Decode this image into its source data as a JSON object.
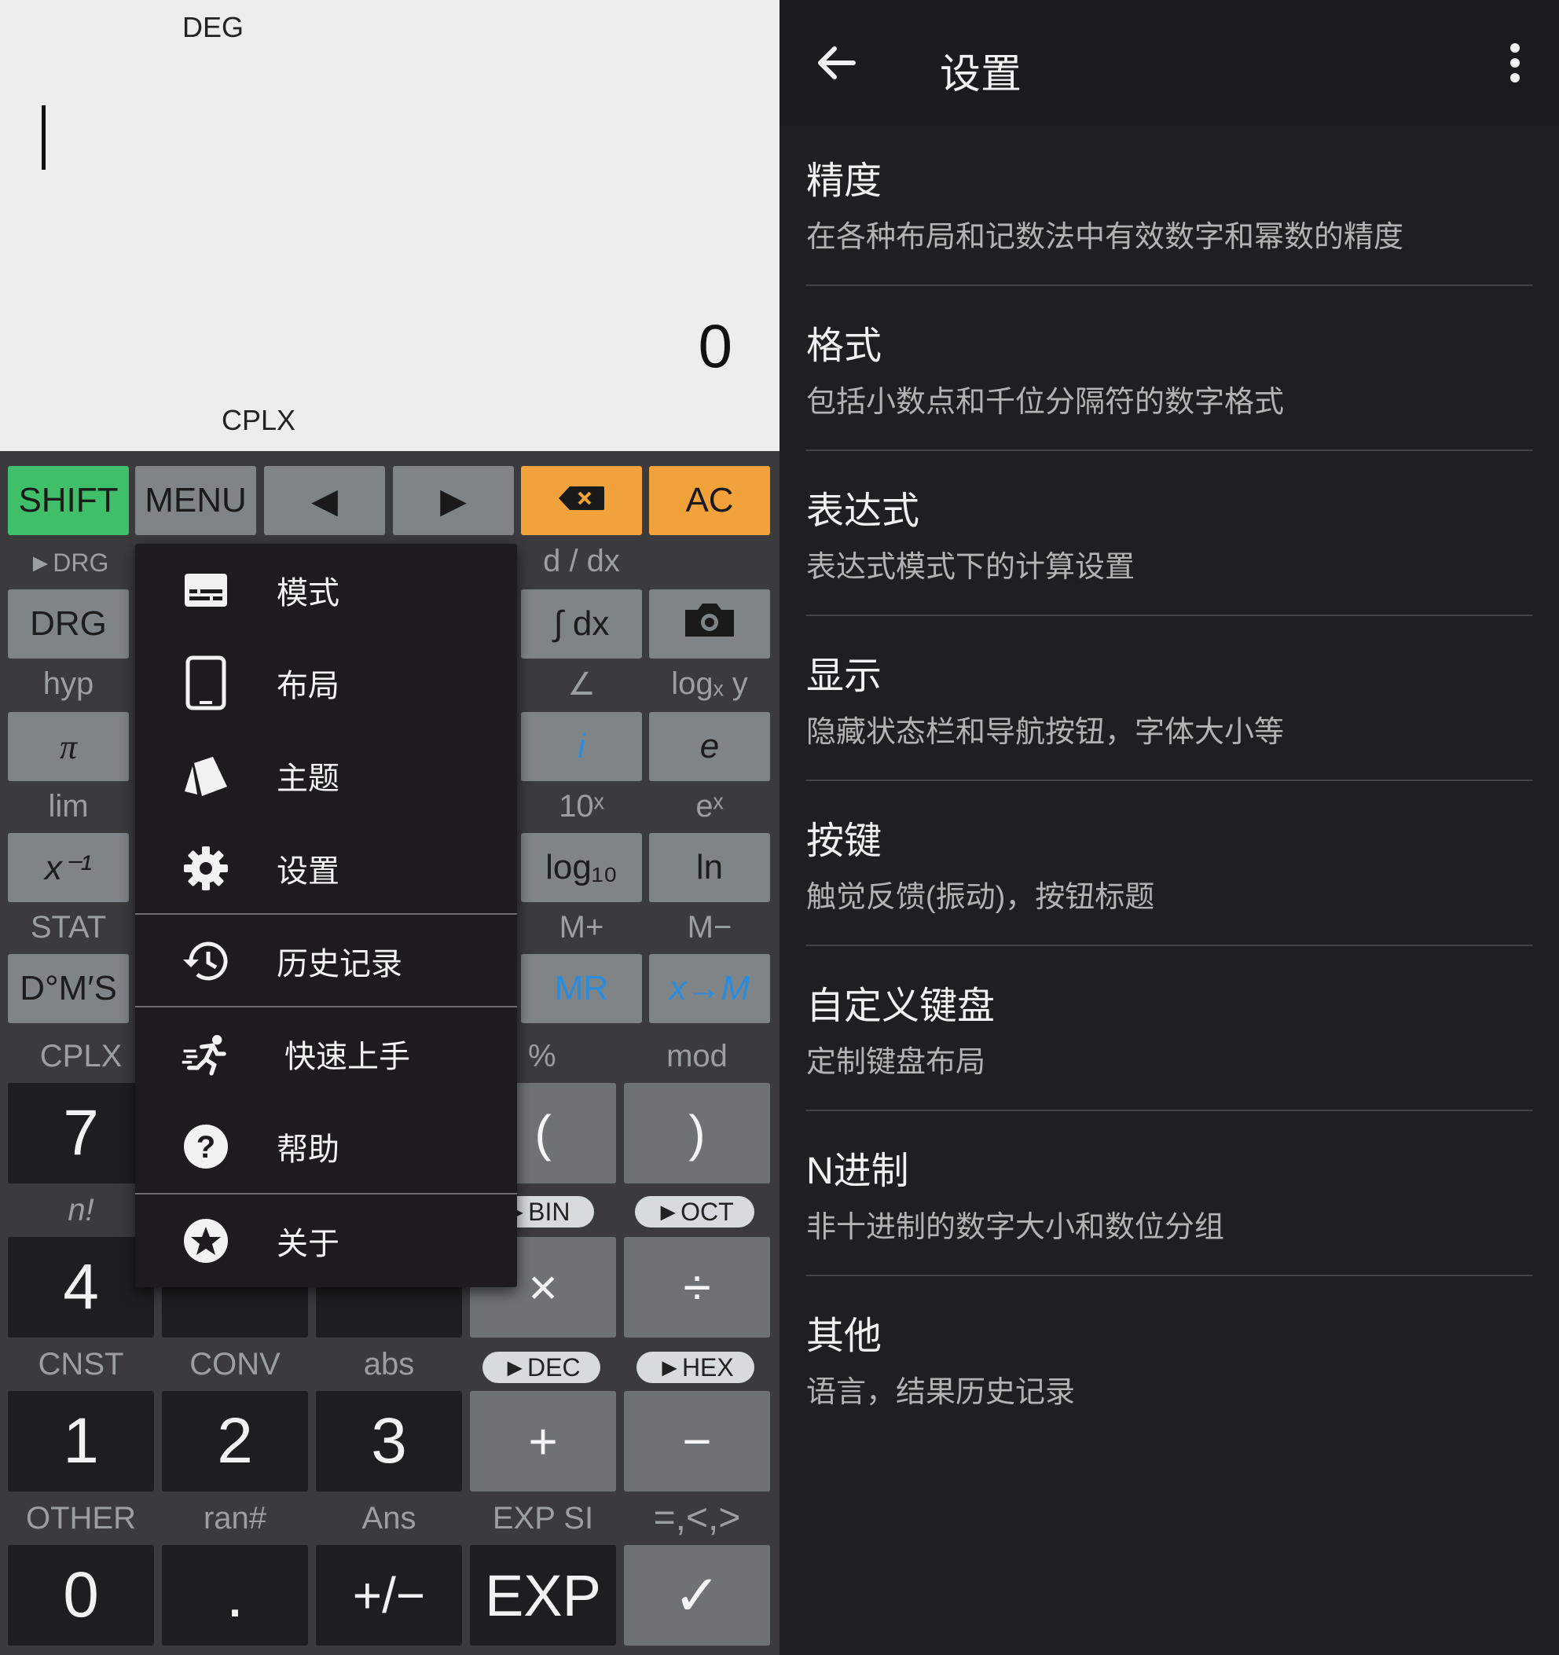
{
  "calculator": {
    "display": {
      "angle_mode": "DEG",
      "result": "0",
      "complex_indicator": "CPLX"
    },
    "top_row": {
      "shift": "SHIFT",
      "menu": "MENU",
      "left": "◀",
      "right": "▶",
      "clear": "AC"
    },
    "row1": {
      "label_drg": "►DRG",
      "drg": "DRG",
      "label_ddx": "d / dx",
      "integral": "∫ dx"
    },
    "row2": {
      "label_hyp": "hyp",
      "pi": "π",
      "label_angle": "∠",
      "label_log": "logₓ y",
      "i": "i",
      "e": "e"
    },
    "row3": {
      "label_lim": "lim",
      "inverse": "x⁻¹",
      "label_10x": "10ˣ",
      "label_ex": "eˣ",
      "log10": "log₁₀",
      "ln": "ln"
    },
    "row4": {
      "label_stat": "STAT",
      "dms": "D°M′S",
      "label_mplus": "M+",
      "label_mminus": "M−",
      "mr": "MR",
      "xm": "x→M"
    },
    "row5": {
      "label_cplx": "CPLX",
      "seven": "7",
      "label_percent": "%",
      "label_mod": "mod",
      "lparen": "(",
      "rparen": ")"
    },
    "row6": {
      "label_fact": "n!",
      "four": "4",
      "bin": "►BIN",
      "oct": "►OCT",
      "times": "×",
      "divide": "÷"
    },
    "row7": {
      "label_cnst": "CNST",
      "label_conv": "CONV",
      "label_abs": "abs",
      "dec": "►DEC",
      "hex": "►HEX",
      "one": "1",
      "two": "2",
      "three": "3",
      "plus": "+",
      "minus": "−"
    },
    "row8": {
      "label_other": "OTHER",
      "label_ran": "ran#",
      "label_ans": "Ans",
      "label_expsi": "EXP SI",
      "label_cmp": "=,<,>",
      "zero": "0",
      "dot": ".",
      "neg": "+/−",
      "exp": "EXP",
      "check": "✓"
    }
  },
  "menu": {
    "items": [
      {
        "label": "模式",
        "icon": "subtitles-icon"
      },
      {
        "label": "布局",
        "icon": "tablet-icon"
      },
      {
        "label": "主题",
        "icon": "cards-icon"
      },
      {
        "label": "设置",
        "icon": "gear-icon"
      },
      {
        "label": "历史记录",
        "icon": "history-icon"
      },
      {
        "label": "快速上手",
        "icon": "running-icon"
      },
      {
        "label": "帮助",
        "icon": "help-icon"
      },
      {
        "label": "关于",
        "icon": "star-icon"
      }
    ]
  },
  "settings": {
    "title": "设置",
    "items": [
      {
        "title": "精度",
        "subtitle": "在各种布局和记数法中有效数字和幂数的精度"
      },
      {
        "title": "格式",
        "subtitle": "包括小数点和千位分隔符的数字格式"
      },
      {
        "title": "表达式",
        "subtitle": "表达式模式下的计算设置"
      },
      {
        "title": "显示",
        "subtitle": "隐藏状态栏和导航按钮，字体大小等"
      },
      {
        "title": "按键",
        "subtitle": "触觉反馈(振动)，按钮标题"
      },
      {
        "title": "自定义键盘",
        "subtitle": "定制键盘布局"
      },
      {
        "title": "N进制",
        "subtitle": "非十进制的数字大小和数位分组"
      },
      {
        "title": "其他",
        "subtitle": "语言，结果历史记录"
      }
    ]
  },
  "colors": {
    "shift": "#3fbf69",
    "accent_orange": "#f2a23a",
    "blue_text": "#2b8bdc"
  }
}
